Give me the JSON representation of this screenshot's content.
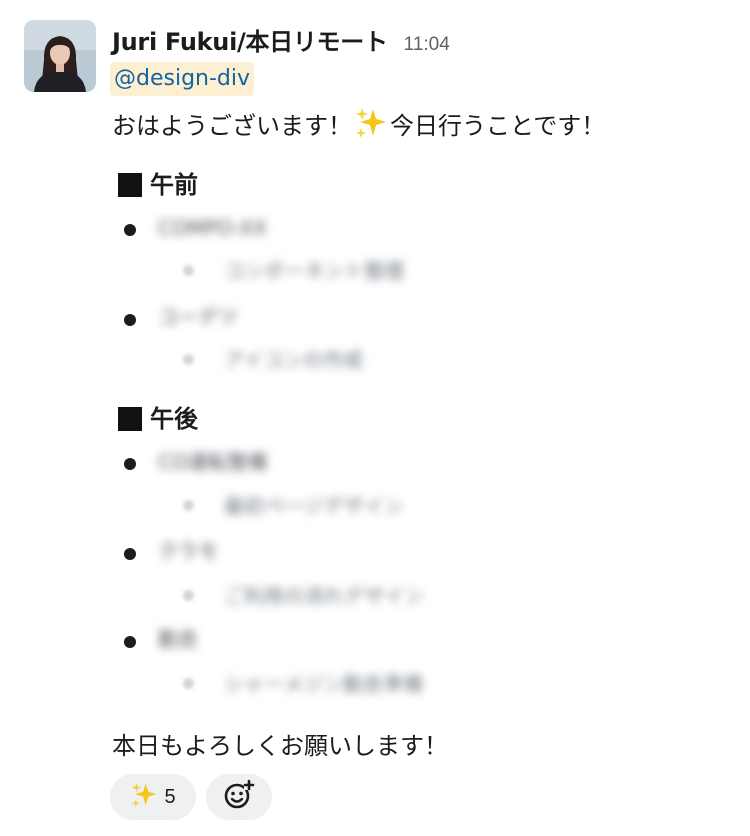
{
  "message": {
    "sender_name": "Juri Fukui/本日リモート",
    "timestamp": "11:04",
    "mention": "@design-div",
    "greeting_before": "おはようございます！",
    "greeting_after": "今日行うことです！",
    "sections": [
      {
        "heading": "午前",
        "items": [
          {
            "title": "COMPO-XX",
            "sub": "コンポーネント整理"
          },
          {
            "title": "コーデツ",
            "sub": "アイコンの作成"
          }
        ]
      },
      {
        "heading": "午後",
        "items": [
          {
            "title": "CO運転整備",
            "sub": "最初ページデザイン"
          },
          {
            "title": "クラモ",
            "sub": "ご利用の流れデザイン"
          },
          {
            "title": "勤怠",
            "sub": "シャーメジン勤怠準備"
          }
        ]
      }
    ],
    "closing": "本日もよろしくお願いします！",
    "reactions": [
      {
        "emoji_icon": "sparkles-emoji-icon",
        "count": "5"
      }
    ],
    "add_reaction_icon": "add-reaction-icon"
  },
  "colors": {
    "mention_bg": "#fcefd2",
    "mention_text": "#1264a3",
    "reaction_bg": "#eef0f2",
    "sparkle_gold": "#f5c518"
  }
}
